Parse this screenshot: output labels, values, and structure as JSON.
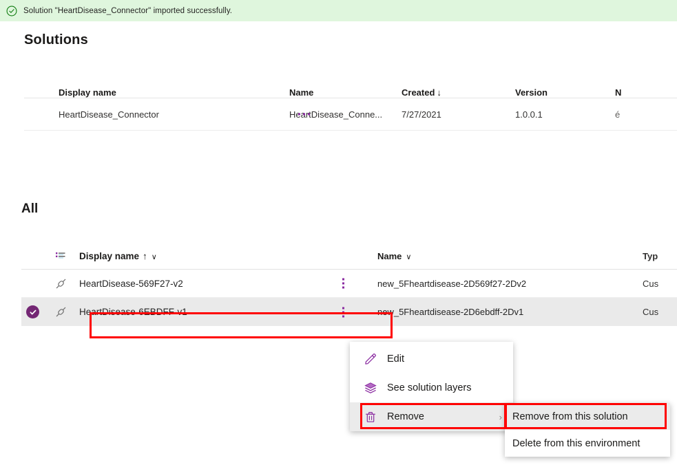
{
  "banner": {
    "icon": "check-circle-icon",
    "message": "Solution \"HeartDisease_Connector\" imported successfully."
  },
  "page": {
    "title": "Solutions",
    "all_title": "All"
  },
  "solutions_table": {
    "columns": [
      "Display name",
      "Name",
      "Created",
      "Version",
      "N"
    ],
    "sort_column": "Created",
    "sort_arrow": "↓",
    "rows": [
      {
        "display_name": "HeartDisease_Connector",
        "name": "HeartDisease_Conne...",
        "created": "7/27/2021",
        "version": "1.0.0.1",
        "managed": "é",
        "overflow": "..."
      }
    ]
  },
  "all_table": {
    "columns": {
      "type_icon": "list-sort-icon",
      "display_name": "Display name",
      "display_name_sort": "↑",
      "display_name_chevron": "∨",
      "name": "Name",
      "name_chevron": "∨",
      "type": "Typ"
    },
    "rows": [
      {
        "selected": false,
        "icon": "connector-plug-icon",
        "display_name": "HeartDisease-569F27-v2",
        "name": "new_5Fheartdisease-2D569f27-2Dv2",
        "type": "Cus"
      },
      {
        "selected": true,
        "icon": "connector-plug-icon",
        "display_name": "HeartDisease-6EBDFF-v1",
        "name": "new_5Fheartdisease-2D6ebdff-2Dv1",
        "type": "Cus"
      }
    ]
  },
  "context_menu": {
    "items": [
      {
        "label": "Edit",
        "icon": "pencil-icon",
        "highlighted": false,
        "has_submenu": false
      },
      {
        "label": "See solution layers",
        "icon": "layers-icon",
        "highlighted": false,
        "has_submenu": false
      },
      {
        "label": "Remove",
        "icon": "trash-icon",
        "highlighted": true,
        "has_submenu": true,
        "arrow": "›"
      }
    ]
  },
  "submenu": {
    "items": [
      {
        "label": "Remove from this solution",
        "highlighted": true
      },
      {
        "label": "Delete from this environment",
        "highlighted": false
      }
    ]
  },
  "colors": {
    "accent_purple": "#742774",
    "ellipsis_purple": "#8a2ba0",
    "banner_background": "#dff6dd",
    "banner_icon": "#107c10",
    "annotation_red": "#ff0000",
    "selected_row": "#eaeaea",
    "menu_highlight": "#ebebeb"
  },
  "annotations": [
    {
      "name": "selected-row-display-name-highlight"
    },
    {
      "name": "remove-menu-item-highlight"
    },
    {
      "name": "remove-from-this-solution-highlight"
    }
  ]
}
